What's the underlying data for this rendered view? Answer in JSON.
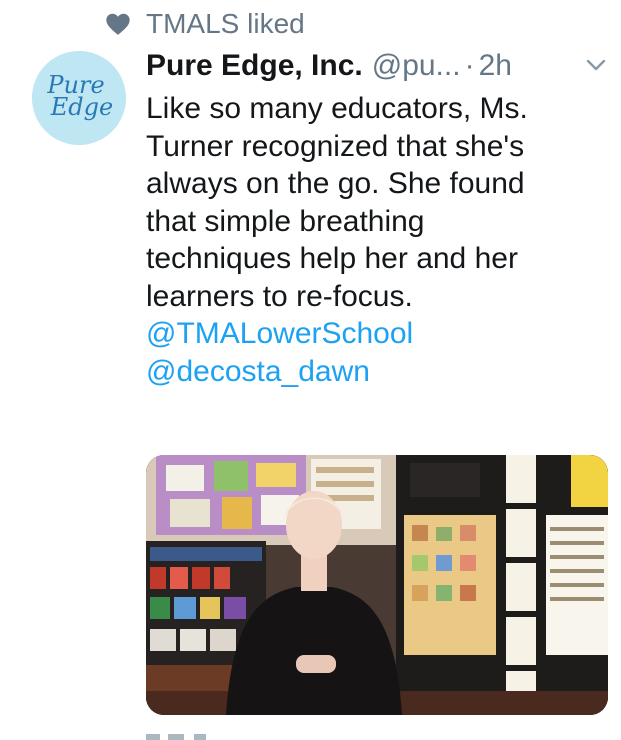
{
  "social_context": {
    "text": "TMALS liked",
    "icon": "heart-icon"
  },
  "avatar": {
    "line1": "Pure",
    "line2": "Edge",
    "bg_color": "#bfe6f3",
    "text_color": "#2a79b5"
  },
  "tweet": {
    "display_name": "Pure Edge, Inc.",
    "handle": "@pu...",
    "separator": "·",
    "time": "2h",
    "body_lines": [
      "Like so many educators, Ms.",
      "Turner recognized that she's",
      "always on the go. She found",
      "that simple breathing",
      "techniques help her and her",
      "learners to re-focus."
    ],
    "mentions": [
      "@TMALowerSchool",
      "@decosta_dawn"
    ]
  },
  "colors": {
    "link": "#1da1f2",
    "secondary_text": "#657786",
    "primary_text": "#14171a"
  }
}
